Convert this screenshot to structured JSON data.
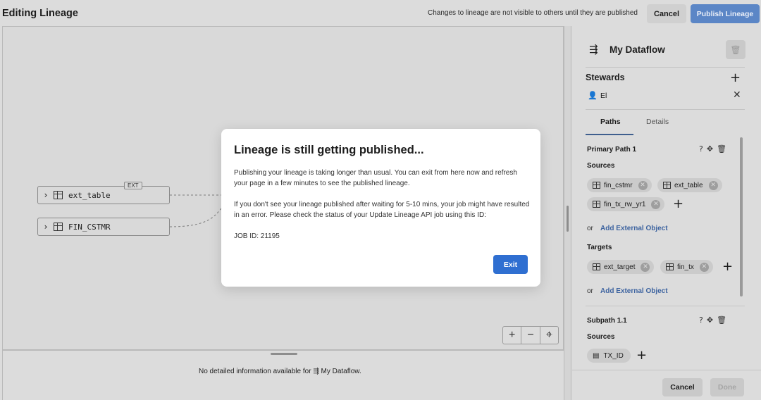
{
  "header": {
    "title": "Editing Lineage",
    "notice": "Changes to lineage are not visible to others until they are published",
    "cancel_label": "Cancel",
    "publish_label": "Publish Lineage",
    "publish_color": "#5b86c6"
  },
  "canvas": {
    "nodes": [
      {
        "label": "ext_table",
        "badge": "EXT"
      },
      {
        "label": "FIN_CSTMR"
      }
    ],
    "zoom": {
      "in": "+",
      "out": "−",
      "fit": "⌖"
    }
  },
  "detail": {
    "prefix": "No detailed information available for",
    "object": "My Dataflow",
    "suffix": "."
  },
  "panel": {
    "icon": "dataflow-icon",
    "title": "My Dataflow",
    "stewards_heading": "Stewards",
    "steward": "El",
    "tabs": [
      {
        "label": "Paths",
        "active": true
      },
      {
        "label": "Details",
        "active": false
      }
    ],
    "primary_path": {
      "title": "Primary Path 1",
      "sources_heading": "Sources",
      "sources": [
        "fin_cstmr",
        "ext_table",
        "fin_tx_rw_yr1"
      ],
      "or": "or",
      "add_external": "Add External Object",
      "targets_heading": "Targets",
      "targets": [
        "ext_target",
        "fin_tx"
      ]
    },
    "subpath": {
      "title": "Subpath 1.1",
      "sources_heading": "Sources",
      "sources": [
        "TX_ID"
      ]
    },
    "footer": {
      "cancel_label": "Cancel",
      "done_label": "Done"
    }
  },
  "modal": {
    "title": "Lineage is still getting published...",
    "para1": "Publishing your lineage is taking longer than usual. You can exit from here now and refresh your page in a few minutes to see the published lineage.",
    "para2": "If you don't see your lineage published after waiting for 5-10 mins, your job might have resulted in an error. Please check the status of your Update Lineage API job using this ID:",
    "job_id": "JOB ID: 21195",
    "exit_label": "Exit",
    "exit_color": "#2f6fd1"
  }
}
